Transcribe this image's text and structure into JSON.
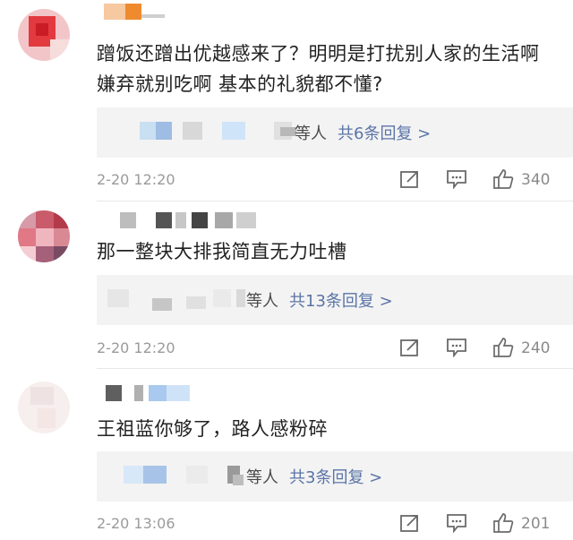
{
  "comments": [
    {
      "text": "蹭饭还蹭出优越感来了？明明是打扰别人家的生活啊 嫌弃就别吃啊 基本的礼貌都不懂?",
      "reply_summary": "等人",
      "reply_link": "共6条回复 >",
      "time": "2-20 12:20",
      "likes": "340"
    },
    {
      "text": "那一整块大排我简直无力吐槽",
      "reply_summary": "等人",
      "reply_link": "共13条回复 >",
      "time": "2-20 12:20",
      "likes": "240"
    },
    {
      "text": "王祖蓝你够了，路人感粉碎",
      "reply_summary": "等人",
      "reply_link": "共3条回复 >",
      "time": "2-20 13:06",
      "likes": "201"
    }
  ],
  "icons": {
    "share": "share-icon",
    "comment": "comment-icon",
    "like": "thumbs-up-icon"
  },
  "colors": {
    "link": "#5b74a7",
    "meta": "#9a9a9a",
    "reply_bg": "#f3f3f3"
  }
}
